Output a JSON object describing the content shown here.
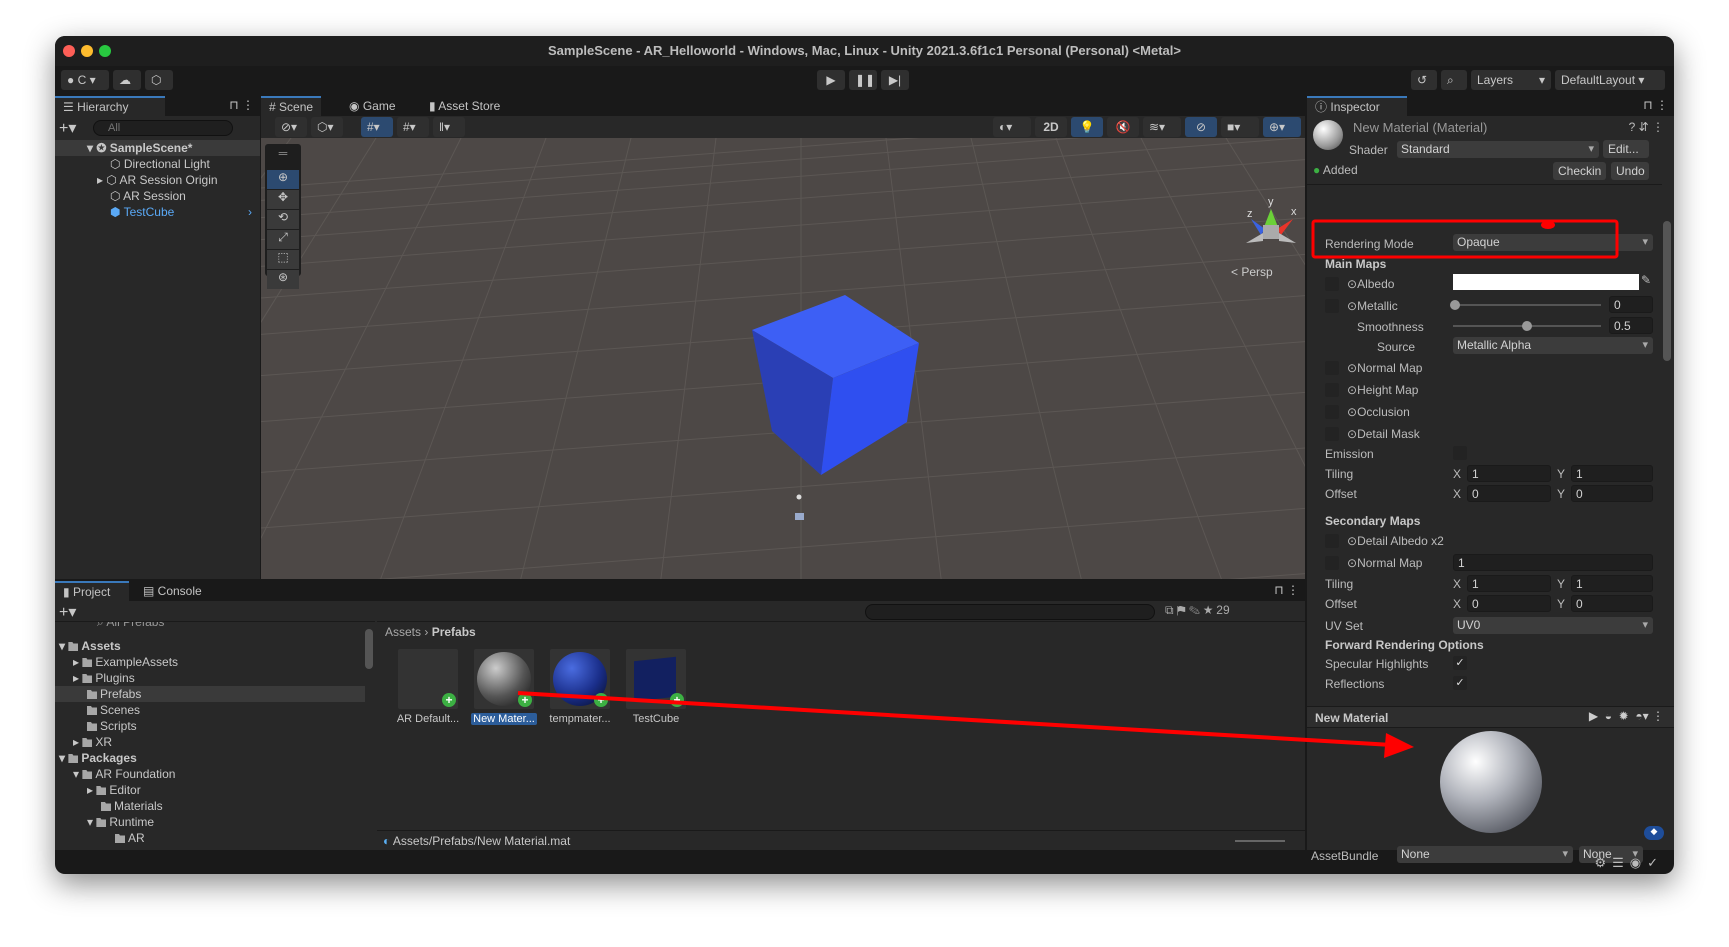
{
  "window": {
    "title": "SampleScene - AR_Helloworld - Windows, Mac, Linux - Unity 2021.3.6f1c1 Personal (Personal) <Metal>"
  },
  "toolbar": {
    "account": "C",
    "layers": "Layers",
    "layout": "DefaultLayout"
  },
  "hierarchy": {
    "tab": "Hierarchy",
    "search_placeholder": "All",
    "scene": "SampleScene*",
    "items": [
      {
        "label": "Directional Light"
      },
      {
        "label": "AR Session Origin"
      },
      {
        "label": "AR Session"
      },
      {
        "label": "TestCube"
      }
    ]
  },
  "scene": {
    "tabs": [
      "Scene",
      "Game",
      "Asset Store"
    ],
    "btn_2d": "2D",
    "persp": "Persp",
    "gizmo": {
      "x": "x",
      "y": "y",
      "z": "z"
    },
    "cube_color": "#2f4ff0"
  },
  "project": {
    "tabs": [
      "Project",
      "Console"
    ],
    "tree_search": "All Prefabs",
    "tree": [
      {
        "label": "Assets"
      },
      {
        "label": "ExampleAssets"
      },
      {
        "label": "Plugins"
      },
      {
        "label": "Prefabs"
      },
      {
        "label": "Scenes"
      },
      {
        "label": "Scripts"
      },
      {
        "label": "XR"
      },
      {
        "label": "Packages"
      },
      {
        "label": "AR Foundation"
      },
      {
        "label": "Editor"
      },
      {
        "label": "Materials"
      },
      {
        "label": "Runtime"
      },
      {
        "label": "AR"
      }
    ],
    "breadcrumb": [
      "Assets",
      "Prefabs"
    ],
    "hidden_count": "29",
    "assets": [
      {
        "label": "AR Default..."
      },
      {
        "label": "New Mater..."
      },
      {
        "label": "tempmater..."
      },
      {
        "label": "TestCube"
      }
    ],
    "path": "Assets/Prefabs/New Material.mat"
  },
  "inspector": {
    "tab": "Inspector",
    "title": "New Material (Material)",
    "shader_label": "Shader",
    "shader": "Standard",
    "edit": "Edit...",
    "added": "Added",
    "checkin": "Checkin",
    "undo": "Undo",
    "rendering_mode_label": "Rendering Mode",
    "rendering_mode": "Opaque",
    "main_maps": "Main Maps",
    "albedo": "Albedo",
    "albedo_color": "#ffffff",
    "metallic": "Metallic",
    "metallic_value": "0",
    "smoothness": "Smoothness",
    "smoothness_value": "0.5",
    "source_label": "Source",
    "source": "Metallic Alpha",
    "normal_map": "Normal Map",
    "height_map": "Height Map",
    "occlusion": "Occlusion",
    "detail_mask": "Detail Mask",
    "emission": "Emission",
    "tiling": "Tiling",
    "offset": "Offset",
    "x": "X",
    "y": "Y",
    "tiling_x": "1",
    "tiling_y": "1",
    "offset_x": "0",
    "offset_y": "0",
    "secondary_maps": "Secondary Maps",
    "detail_albedo": "Detail Albedo x2",
    "normal_map2": "Normal Map",
    "normal_scale": "1",
    "tiling2_x": "1",
    "tiling2_y": "1",
    "offset2_x": "0",
    "offset2_y": "0",
    "uv_set_label": "UV Set",
    "uv_set": "UV0",
    "forward": "Forward Rendering Options",
    "specular": "Specular Highlights",
    "reflections": "Reflections",
    "preview_title": "New Material",
    "assetbundle_label": "AssetBundle",
    "assetbundle": "None",
    "assetbundle_variant": "None"
  },
  "annotation": {
    "color": "#ff0000"
  }
}
